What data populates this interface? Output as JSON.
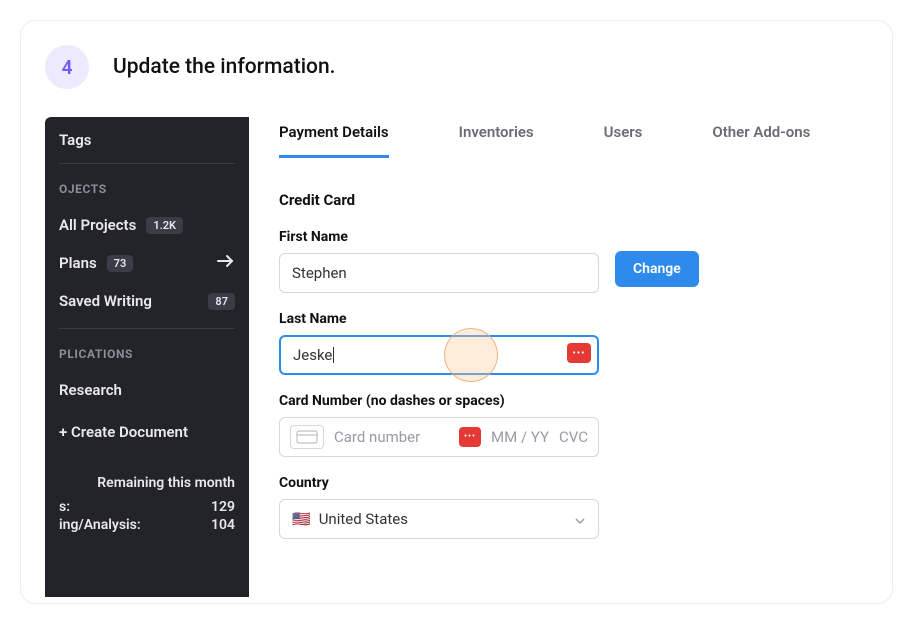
{
  "step": {
    "number": "4",
    "title": "Update the information."
  },
  "sidebar": {
    "tags": "Tags",
    "section_projects": "OJECTS",
    "items": [
      {
        "label": "All Projects",
        "badge": "1.2K",
        "arrow": false
      },
      {
        "label": "Plans",
        "badge": "73",
        "arrow": true
      },
      {
        "label": "Saved Writing",
        "badge": "87",
        "arrow": false
      }
    ],
    "section_apps": "PLICATIONS",
    "research": "Research",
    "create": "+ Create Document",
    "remaining_label": "Remaining this month",
    "stat1_label": "s:",
    "stat1_value": "129",
    "stat2_label": "ing/Analysis:",
    "stat2_value": "104"
  },
  "tabs": [
    {
      "label": "Payment Details",
      "active": true
    },
    {
      "label": "Inventories",
      "active": false
    },
    {
      "label": "Users",
      "active": false
    },
    {
      "label": "Other Add-ons",
      "active": false
    }
  ],
  "form": {
    "section_title": "Credit Card",
    "first_name_label": "First Name",
    "first_name_value": "Stephen",
    "last_name_label": "Last Name",
    "last_name_value": "Jeske",
    "card_label": "Card Number (no dashes or spaces)",
    "card_placeholder": "Card number",
    "mm_yy": "MM / YY",
    "cvc": "CVC",
    "country_label": "Country",
    "country_flag": "🇺🇸",
    "country_value": "United States",
    "change_button": "Change"
  }
}
